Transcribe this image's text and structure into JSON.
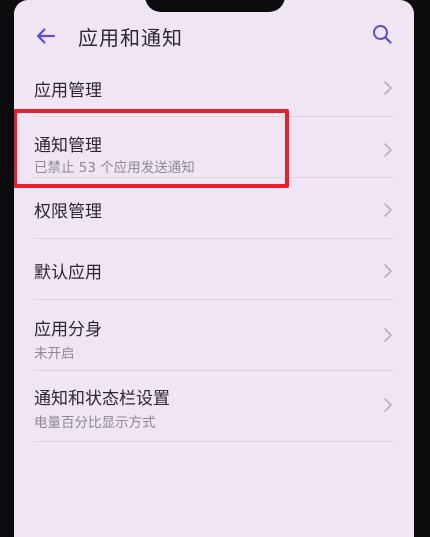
{
  "header": {
    "title": "应用和通知"
  },
  "menu": [
    {
      "title": "应用管理",
      "subtitle": ""
    },
    {
      "title": "通知管理",
      "subtitle": "已禁止 53 个应用发送通知"
    },
    {
      "title": "权限管理",
      "subtitle": ""
    },
    {
      "title": "默认应用",
      "subtitle": ""
    },
    {
      "title": "应用分身",
      "subtitle": "未开启"
    },
    {
      "title": "通知和状态栏设置",
      "subtitle": "电量百分比显示方式"
    }
  ],
  "icons": {
    "back": "arrow-left-icon",
    "search": "search-icon",
    "chevron": "chevron-right-icon"
  },
  "colors": {
    "accent": "#5b4fd0",
    "highlight": "#e8202a",
    "background": "#f0e6f3"
  }
}
